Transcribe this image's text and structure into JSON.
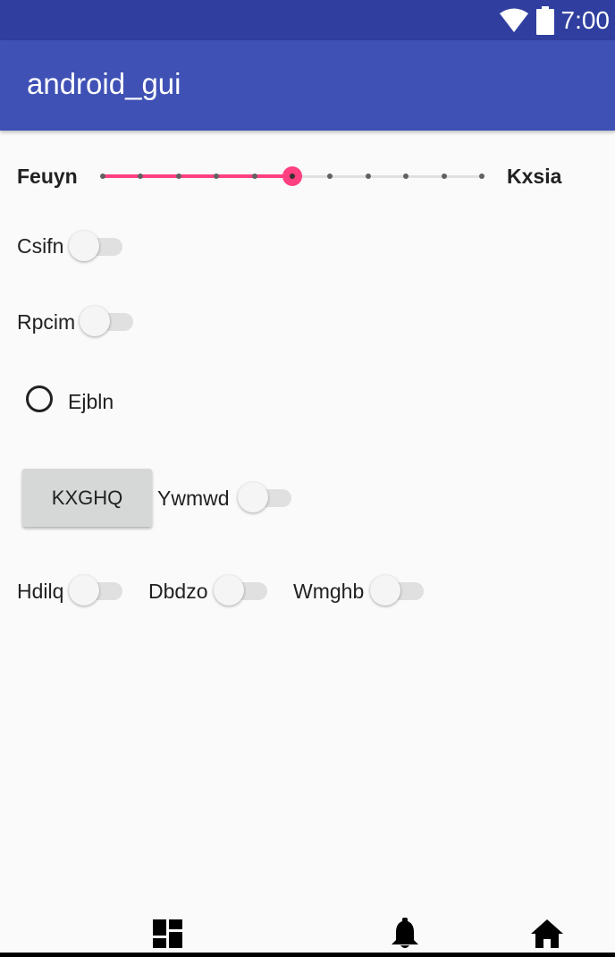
{
  "status_bar": {
    "time": "7:00",
    "icons": [
      "wifi-icon",
      "battery-icon"
    ]
  },
  "app_bar": {
    "title": "android_gui"
  },
  "seekbar_row": {
    "left_label": "Feuyn",
    "right_label": "Kxsia",
    "seekbar": {
      "steps": 10,
      "value": 5,
      "progress": 0.5,
      "accent_color": "#ff4081"
    }
  },
  "switches": {
    "csifn": {
      "label": "Csifn",
      "checked": false
    },
    "rpcim": {
      "label": "Rpcim",
      "checked": false
    },
    "ywmwd": {
      "label": "Ywmwd",
      "checked": false
    },
    "hdilq": {
      "label": "Hdilq",
      "checked": false
    },
    "dbdzo": {
      "label": "Dbdzo",
      "checked": false
    },
    "wmghb": {
      "label": "Wmghb",
      "checked": false
    }
  },
  "radio": {
    "label": "Ejbln",
    "checked": false
  },
  "button": {
    "label": "KXGHQ"
  },
  "bottom_nav": {
    "icons": [
      "dashboard-icon",
      "notifications-icon",
      "home-icon"
    ]
  },
  "colors": {
    "status_bar": "#303f9f",
    "app_bar": "#3f51b5",
    "accent": "#ff4081",
    "background": "#fafafa"
  }
}
